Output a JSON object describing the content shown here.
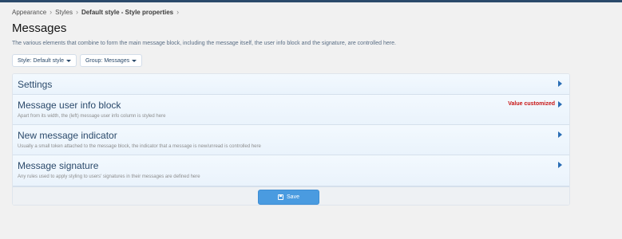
{
  "breadcrumb": {
    "items": [
      "Appearance",
      "Styles",
      "Default style - Style properties"
    ],
    "separator": "›"
  },
  "page": {
    "title": "Messages",
    "description": "The various elements that combine to form the main message block, including the message itself, the user info block and the signature, are controlled here."
  },
  "filters": {
    "style_label": "Style: Default style",
    "group_label": "Group: Messages"
  },
  "sections": [
    {
      "title": "Settings",
      "hint": "",
      "status": ""
    },
    {
      "title": "Message user info block",
      "hint": "Apart from its width, the (left) message user info column is styled here",
      "status": "Value customized"
    },
    {
      "title": "New message indicator",
      "hint": "Usually a small token attached to the message block, the indicator that a message is new/unread is controlled here",
      "status": ""
    },
    {
      "title": "Message signature",
      "hint": "Any rules used to apply styling to users' signatures in their messages are defined here",
      "status": ""
    }
  ],
  "actions": {
    "save_label": "Save"
  },
  "icons": {
    "save": "save-icon",
    "caret": "caret-down-icon",
    "expand": "chevron-right-icon"
  },
  "colors": {
    "header_bar": "#2b4a6b",
    "link": "#2b4a6b",
    "accent": "#4a9be0",
    "customized": "#c81414"
  }
}
